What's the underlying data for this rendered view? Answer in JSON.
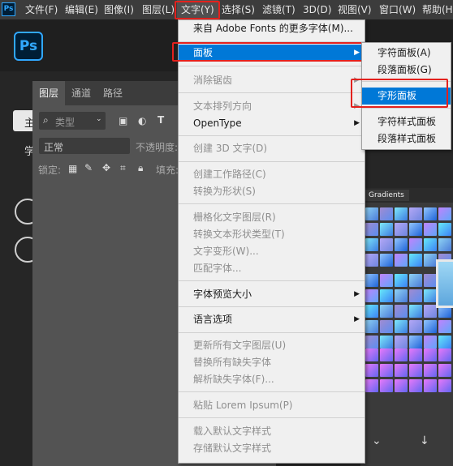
{
  "menubar": {
    "app_icon": "Ps",
    "items": [
      "文件(F)",
      "编辑(E)",
      "图像(I)",
      "图层(L)",
      "文字(Y)",
      "选择(S)",
      "滤镜(T)",
      "3D(D)",
      "视图(V)",
      "窗口(W)",
      "帮助(H)"
    ],
    "active": "文字(Y)"
  },
  "home": {
    "logo": "Ps",
    "sidebar_labels": [
      "主",
      "学"
    ]
  },
  "layers_panel": {
    "tabs": [
      "图层",
      "通道",
      "路径"
    ],
    "filter_placeholder": "类型",
    "blend_mode": "正常",
    "opacity_label": "不透明度:",
    "lock_label": "锁定:",
    "fill_label": "填充:"
  },
  "gradients_panel": {
    "tab": "Gradients"
  },
  "type_menu": {
    "items": [
      {
        "label": "来自 Adobe Fonts 的更多字体(M)...",
        "enabled": true
      },
      {
        "label": "面板",
        "enabled": true,
        "submenu": true,
        "highlighted": true
      },
      {
        "label": "消除锯齿",
        "enabled": false,
        "submenu": true
      },
      {
        "label": "文本排列方向",
        "enabled": false,
        "submenu": true
      },
      {
        "label": "OpenType",
        "enabled": true,
        "submenu": true
      },
      {
        "label": "创建 3D 文字(D)",
        "enabled": false
      },
      {
        "label": "创建工作路径(C)",
        "enabled": false
      },
      {
        "label": "转换为形状(S)",
        "enabled": false
      },
      {
        "label": "栅格化文字图层(R)",
        "enabled": false
      },
      {
        "label": "转换文本形状类型(T)",
        "enabled": false
      },
      {
        "label": "文字变形(W)...",
        "enabled": false
      },
      {
        "label": "匹配字体...",
        "enabled": false
      },
      {
        "label": "字体预览大小",
        "enabled": true,
        "submenu": true
      },
      {
        "label": "语言选项",
        "enabled": true,
        "submenu": true
      },
      {
        "label": "更新所有文字图层(U)",
        "enabled": false
      },
      {
        "label": "替换所有缺失字体",
        "enabled": false
      },
      {
        "label": "解析缺失字体(F)...",
        "enabled": false
      },
      {
        "label": "粘贴 Lorem Ipsum(P)",
        "enabled": false
      },
      {
        "label": "载入默认文字样式",
        "enabled": false
      },
      {
        "label": "存储默认文字样式",
        "enabled": false
      }
    ]
  },
  "panels_submenu": {
    "items": [
      {
        "label": "字符面板(A)"
      },
      {
        "label": "段落面板(G)"
      },
      {
        "label": "字形面板",
        "highlighted": true
      },
      {
        "label": "字符样式面板"
      },
      {
        "label": "段落样式面板"
      }
    ]
  },
  "colors": {
    "highlight": "#0078d7",
    "annotation_red": "#e3211d",
    "ps_blue": "#31a8ff"
  }
}
